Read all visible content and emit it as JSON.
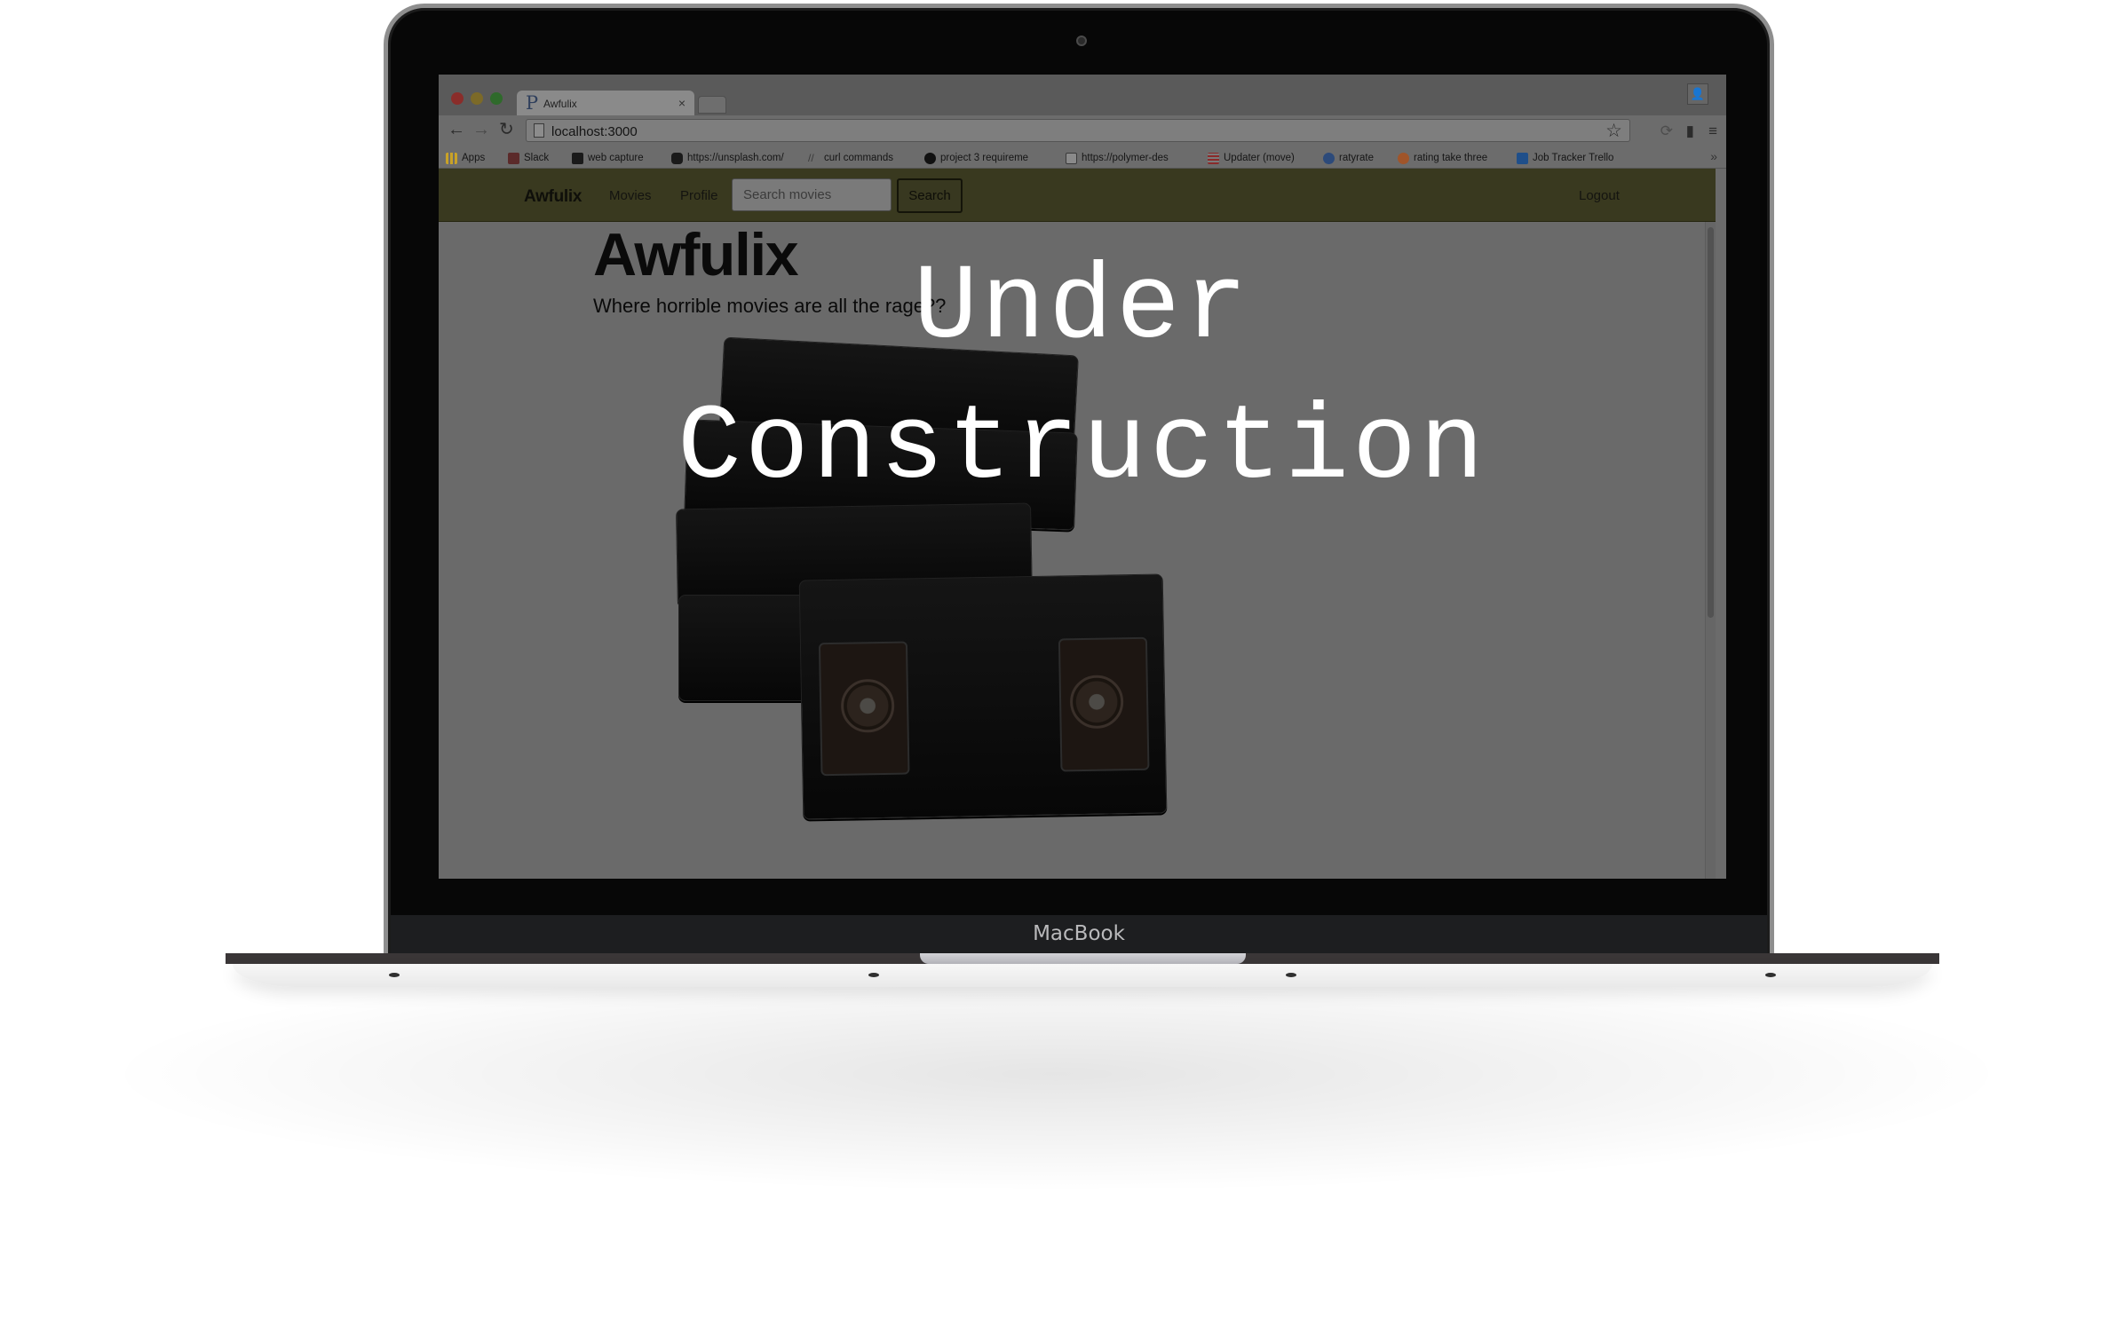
{
  "device": {
    "brand_label": "MacBook"
  },
  "browser": {
    "tab": {
      "title": "Awfulix",
      "favicon_glyph": "P"
    },
    "url": "localhost:3000",
    "bookmarks": [
      {
        "label": "Apps",
        "icon": "apps-grid-icon",
        "color": "#c9a227"
      },
      {
        "label": "Slack",
        "icon": "slack-icon",
        "color": "#5b2a2a"
      },
      {
        "label": "web capture",
        "icon": "capture-icon",
        "color": "#1a1a1a"
      },
      {
        "label": "https://unsplash.com/",
        "icon": "camera-icon",
        "color": "#1a1a1a"
      },
      {
        "label": "curl commands",
        "icon": "link-icon",
        "color": "#5a5a5a"
      },
      {
        "label": "project 3 requireme",
        "icon": "github-icon",
        "color": "#111111"
      },
      {
        "label": "https://polymer-des",
        "icon": "page-icon",
        "color": "#888888"
      },
      {
        "label": "Updater (move)",
        "icon": "updater-icon",
        "color": "#8a2a2a"
      },
      {
        "label": "ratyrate",
        "icon": "ratyrate-icon",
        "color": "#2c4a7a"
      },
      {
        "label": "rating take three",
        "icon": "rating-icon",
        "color": "#a0552a"
      },
      {
        "label": "Job Tracker Trello",
        "icon": "trello-icon",
        "color": "#1f4f8a"
      }
    ],
    "more_glyph": "»"
  },
  "site": {
    "brand": "Awfulix",
    "nav": {
      "movies": "Movies",
      "profile": "Profile",
      "logout": "Logout"
    },
    "search": {
      "placeholder": "Search movies",
      "button": "Search"
    },
    "hero": {
      "title": "Awfulix",
      "subtitle": "Where horrible movies are all the rage??"
    }
  },
  "overlay": {
    "line1": "Under",
    "line2": "Construction"
  },
  "colors": {
    "navbar": "#39391f",
    "page_dimmed": "#6a6a6a",
    "overlay_text": "#ffffff"
  }
}
